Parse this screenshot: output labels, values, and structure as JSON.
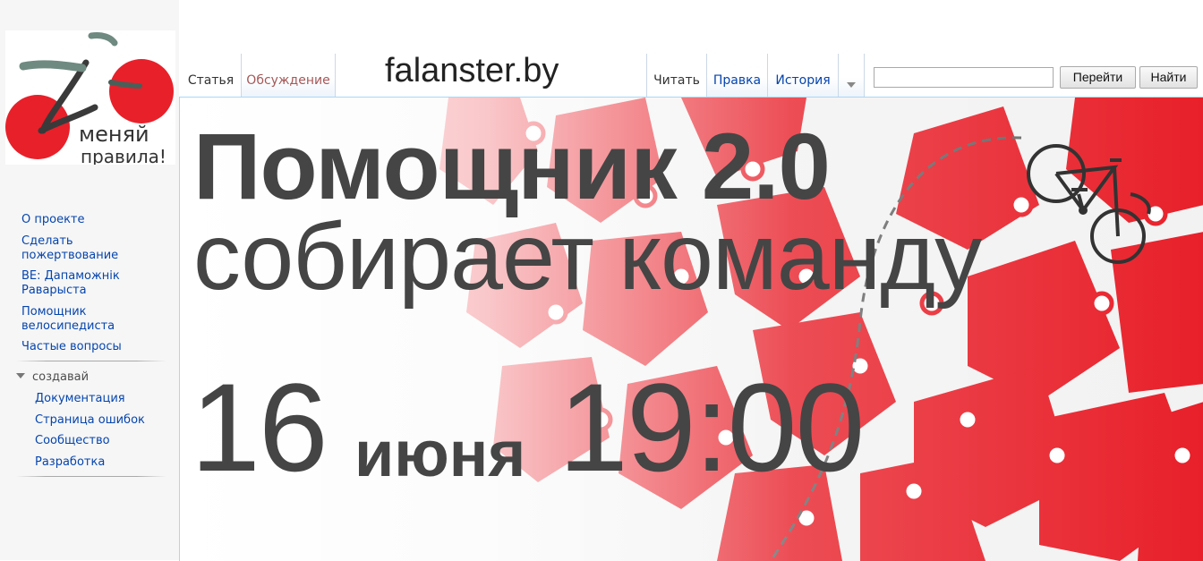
{
  "logo": {
    "text_line1": "меняй",
    "text_line2": "правила!"
  },
  "site_title": "falanster.by",
  "tabs": {
    "article": "Статья",
    "discussion": "Обсуждение",
    "read": "Читать",
    "edit": "Правка",
    "history": "История"
  },
  "search": {
    "value": "",
    "go_label": "Перейти",
    "find_label": "Найти"
  },
  "sidebar": {
    "items": [
      {
        "label": "О проекте"
      },
      {
        "label": "Сделать\nпожертвование"
      },
      {
        "label": "BE: Дапаможнік\nРаварыста"
      },
      {
        "label": "Помощник\nвелосипедиста"
      },
      {
        "label": "Частые вопросы"
      }
    ],
    "section_title": "создавай",
    "section_items": [
      {
        "label": "Документация"
      },
      {
        "label": "Страница ошибок"
      },
      {
        "label": "Сообщество"
      },
      {
        "label": "Разработка"
      }
    ]
  },
  "banner": {
    "line1": "Помощник 2.0",
    "line2": "собирает команду",
    "day": "16",
    "month": "июня",
    "time": "19:00"
  },
  "colors": {
    "accent_red": "#e8202a",
    "link": "#0645ad",
    "discussion_link": "#a55858",
    "headline": "#454545"
  }
}
